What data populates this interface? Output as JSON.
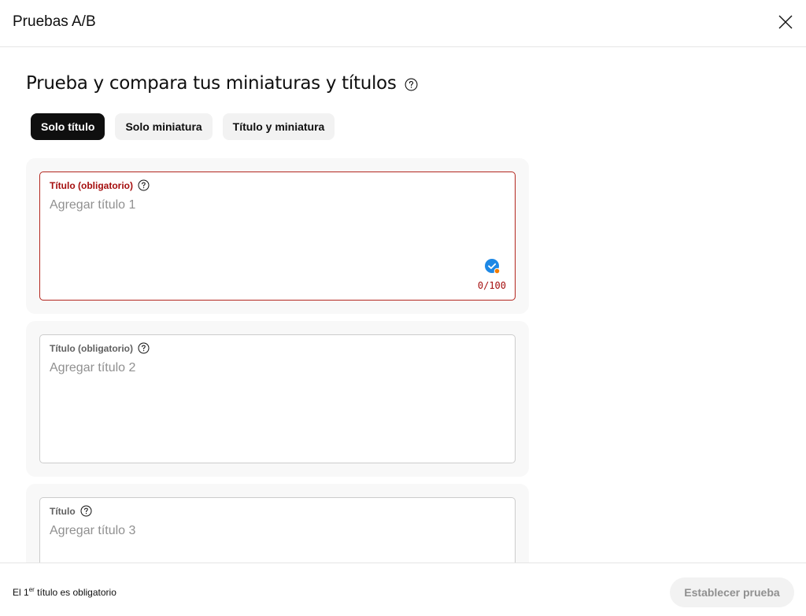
{
  "header": {
    "title": "Pruebas A/B"
  },
  "main": {
    "section_title": "Prueba y compara tus miniaturas y títulos",
    "tabs": [
      {
        "label": "Solo título",
        "active": true
      },
      {
        "label": "Solo miniatura",
        "active": false
      },
      {
        "label": "Título y miniatura",
        "active": false
      }
    ],
    "fields": [
      {
        "label": "Título (obligatorio)",
        "placeholder": "Agregar título 1",
        "counter": "0/100",
        "state": "error"
      },
      {
        "label": "Título (obligatorio)",
        "placeholder": "Agregar título 2"
      },
      {
        "label": "Título",
        "placeholder": "Agregar título 3"
      }
    ]
  },
  "footer": {
    "note_prefix": "El 1",
    "note_sup": "er",
    "note_suffix": " título es obligatorio",
    "submit_label": "Establecer prueba"
  },
  "colors": {
    "error": "#a50e0e",
    "active_chip": "#0f0f0f",
    "check_blue": "#1e88e5",
    "badge_orange": "#f57c00"
  }
}
